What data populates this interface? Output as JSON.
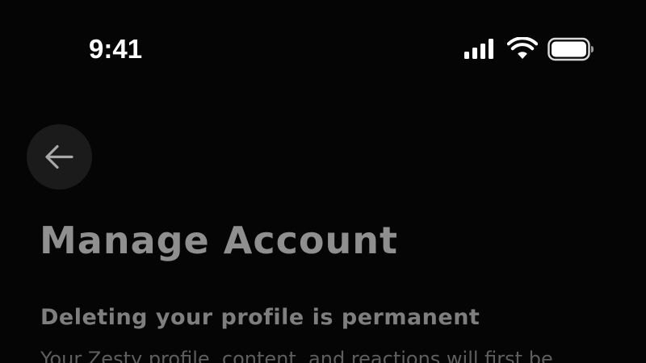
{
  "status_bar": {
    "time": "9:41",
    "icons": [
      "cellular-signal-icon",
      "wifi-icon",
      "battery-icon"
    ]
  },
  "header": {
    "back_icon": "arrow-left-icon"
  },
  "main": {
    "title": "Manage Account",
    "section_heading": "Deleting your profile is permanent",
    "body": "Your Zesty profile, content, and reactions will first be"
  },
  "colors": {
    "background": "#050505",
    "title": "#8f8f8f",
    "heading": "#7e7e7e",
    "body": "#5e5e5e",
    "back_button_bg": "#1b1b1b"
  }
}
